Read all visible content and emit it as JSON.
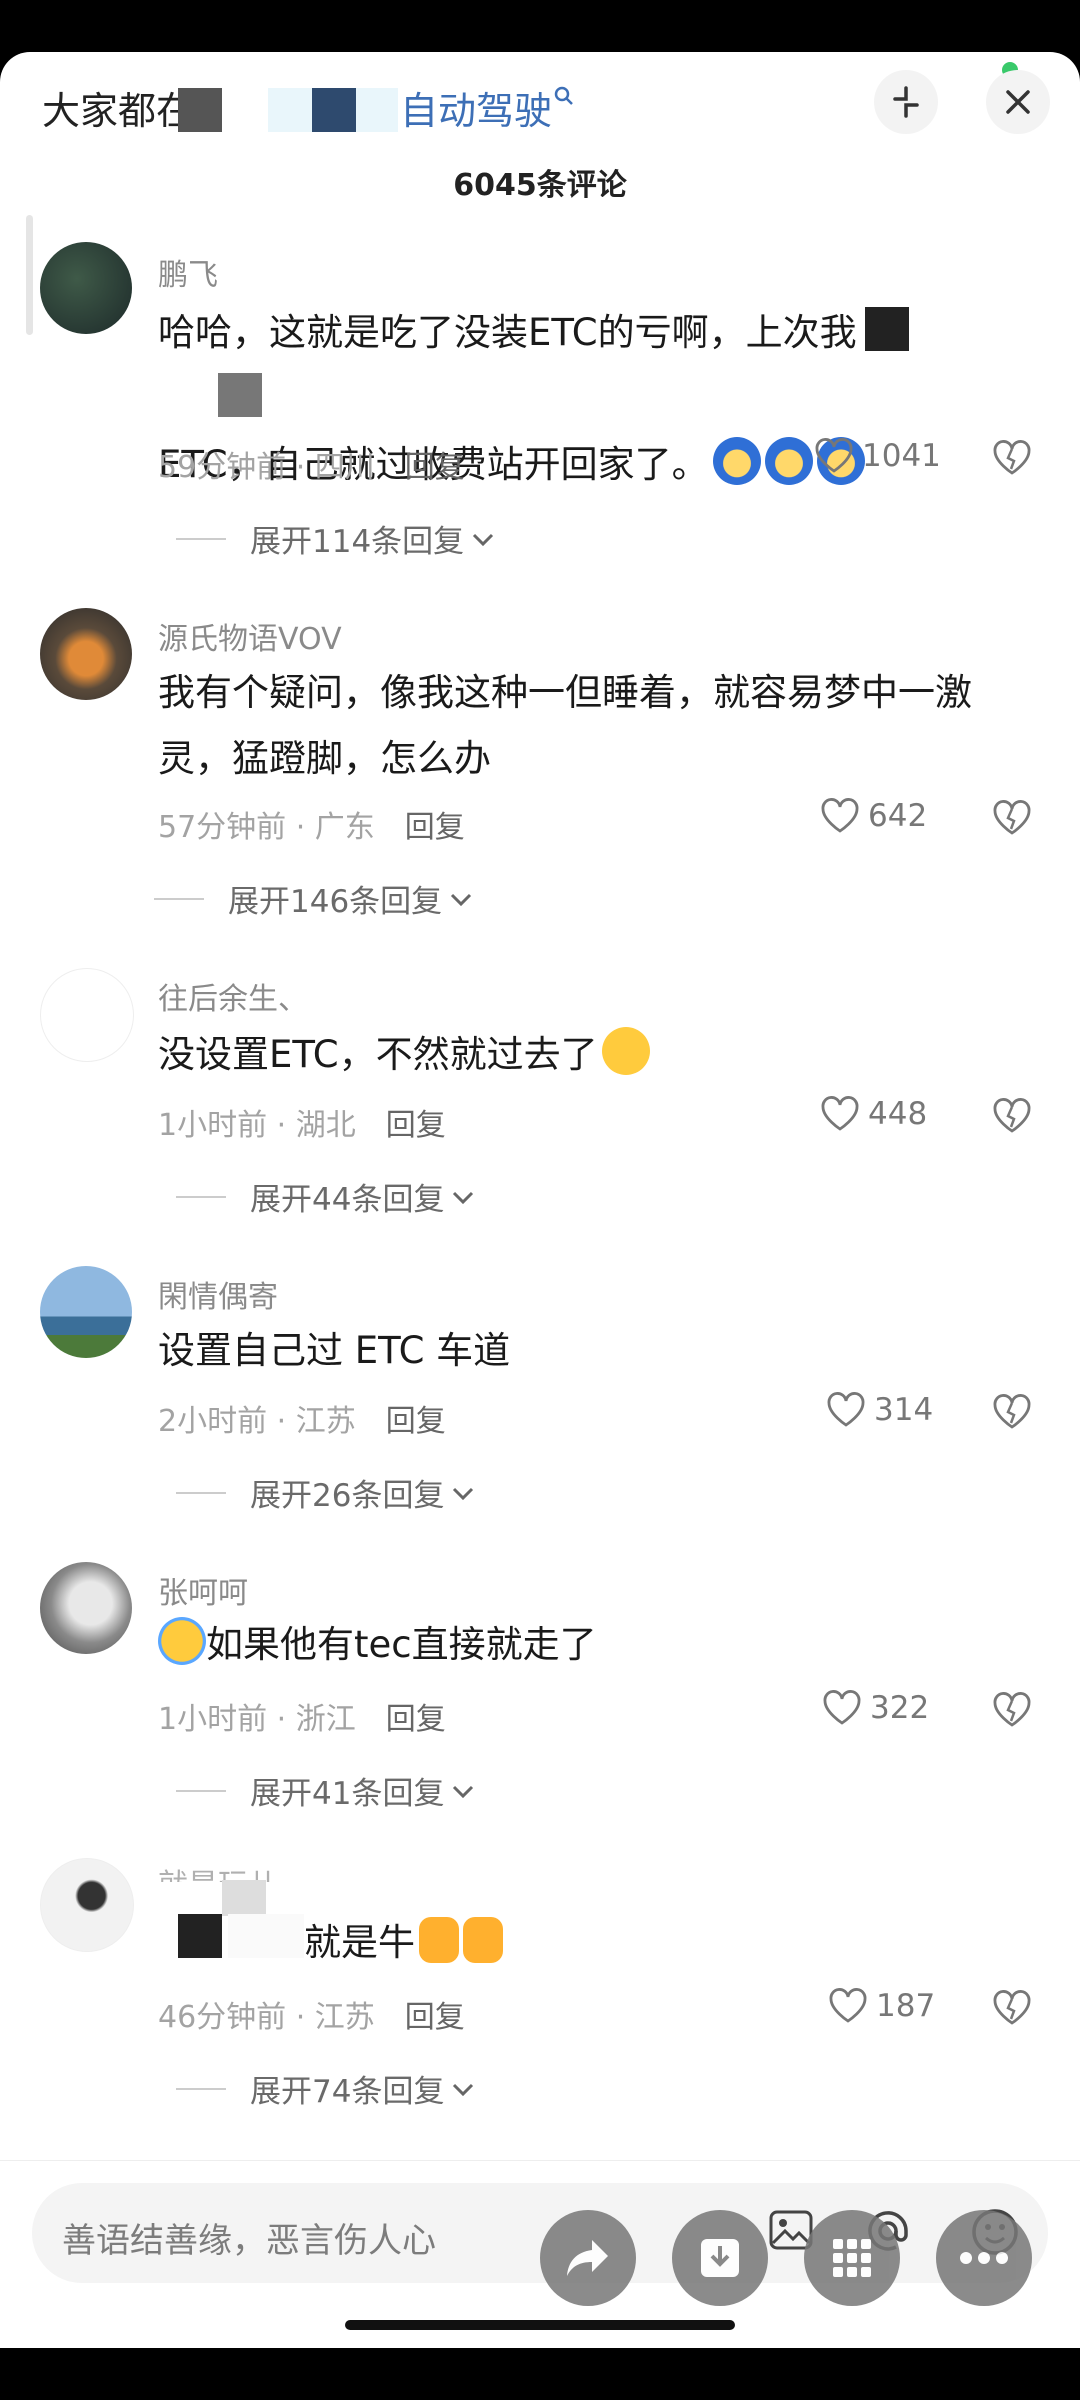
{
  "header": {
    "title_prefix": "大家都在",
    "title_link": "自动驾驶",
    "comment_count": "6045条评论"
  },
  "comments": [
    {
      "username": "鹏飞",
      "text_line1": "哈哈，这就是吃了没装ETC的亏啊，上次我",
      "text_line2": "ETC，自己就过收费站开回家了。",
      "time": "59分钟前",
      "location": "四川",
      "reply": "回复",
      "likes": "1041",
      "expand": "展开114条回复"
    },
    {
      "username": "源氏物语VOV",
      "text_line1": "我有个疑问，像我这种一但睡着，就容易梦中一激",
      "text_line2": "灵，猛蹬脚，怎么办",
      "time": "57分钟前",
      "location": "广东",
      "reply": "回复",
      "likes": "642",
      "expand": "展开146条回复"
    },
    {
      "username": "往后余生、",
      "text_line1": "没设置ETC，不然就过去了",
      "time": "1小时前",
      "location": "湖北",
      "reply": "回复",
      "likes": "448",
      "expand": "展开44条回复"
    },
    {
      "username": "閑情偶寄",
      "text_line1": "设置自己过 ETC 车道",
      "time": "2小时前",
      "location": "江苏",
      "reply": "回复",
      "likes": "314",
      "expand": "展开26条回复"
    },
    {
      "username": "张呵呵",
      "text_line1": "如果他有tec直接就走了",
      "time": "1小时前",
      "location": "浙江",
      "reply": "回复",
      "likes": "322",
      "expand": "展开41条回复"
    },
    {
      "username": "就是玩儿....",
      "text_line1": "就是牛",
      "time": "46分钟前",
      "location": "江苏",
      "reply": "回复",
      "likes": "187",
      "expand": "展开74条回复"
    }
  ],
  "composer": {
    "placeholder": "善语结善缘，恶言伤人心"
  },
  "colors": {
    "link": "#3d6fb6",
    "online_dot": "#39c96a"
  },
  "icons": [
    "collapse-icon",
    "close-icon",
    "heart-icon",
    "broken-heart-icon",
    "chevron-down-icon",
    "image-icon",
    "at-icon",
    "emoji-icon",
    "share-icon",
    "download-icon",
    "grid-icon",
    "more-icon"
  ]
}
